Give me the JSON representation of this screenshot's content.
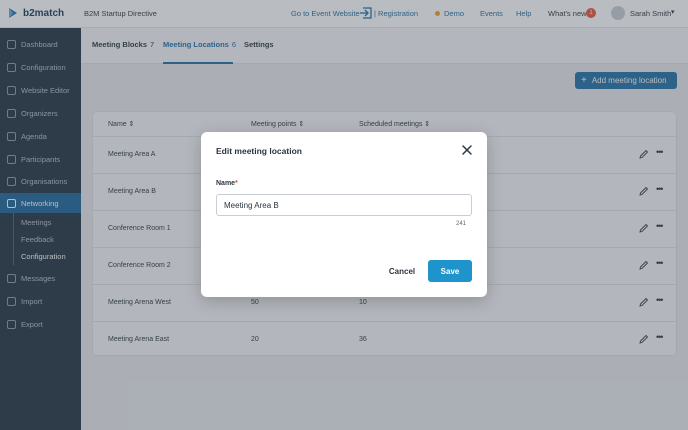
{
  "brand": {
    "name": "b2match",
    "accent": "#1e6fa6",
    "primary_button": "#1f93cc"
  },
  "header": {
    "event_title": "B2M Startup Directive",
    "go_to_event": "Go to Event Website",
    "registration": "| Registration",
    "demo": "Demo",
    "events": "Events",
    "help": "Help",
    "whats_new": "What's new",
    "whats_new_badge": "1",
    "user_name": "Sarah Smith"
  },
  "sidebar": {
    "items": [
      {
        "label": "Dashboard",
        "icon": "dashboard-icon"
      },
      {
        "label": "Configuration",
        "icon": "gear-icon"
      },
      {
        "label": "Website Editor",
        "icon": "website-icon"
      },
      {
        "label": "Organizers",
        "icon": "organizers-icon"
      },
      {
        "label": "Agenda",
        "icon": "calendar-icon"
      },
      {
        "label": "Participants",
        "icon": "participants-icon"
      },
      {
        "label": "Organisations",
        "icon": "building-icon"
      },
      {
        "label": "Networking",
        "icon": "handshake-icon"
      }
    ],
    "networking_sub": [
      {
        "label": "Meetings"
      },
      {
        "label": "Feedback"
      },
      {
        "label": "Configuration"
      }
    ],
    "bottom_items": [
      {
        "label": "Messages",
        "icon": "mail-icon"
      },
      {
        "label": "Import",
        "icon": "import-icon"
      },
      {
        "label": "Export",
        "icon": "export-icon"
      }
    ]
  },
  "tabs": [
    {
      "label": "Meeting Blocks",
      "count": "7"
    },
    {
      "label": "Meeting Locations",
      "count": "6"
    },
    {
      "label": "Settings",
      "count": ""
    }
  ],
  "add_button_label": "Add meeting location",
  "table": {
    "headers": [
      "Name ⇕",
      "Meeting points ⇕",
      "Scheduled meetings ⇕"
    ],
    "rows": [
      {
        "name": "Meeting Area A",
        "points": "",
        "scheduled": ""
      },
      {
        "name": "Meeting Area B",
        "points": "",
        "scheduled": ""
      },
      {
        "name": "Conference Room 1",
        "points": "",
        "scheduled": ""
      },
      {
        "name": "Conference Room 2",
        "points": "",
        "scheduled": ""
      },
      {
        "name": "Meeting Arena West",
        "points": "50",
        "scheduled": "10"
      },
      {
        "name": "Meeting Arena East",
        "points": "20",
        "scheduled": "36"
      }
    ]
  },
  "modal": {
    "title": "Edit meeting location",
    "field_label": "Name",
    "required_mark": "*",
    "field_value": "Meeting Area B",
    "char_count": "241",
    "cancel_label": "Cancel",
    "save_label": "Save"
  }
}
